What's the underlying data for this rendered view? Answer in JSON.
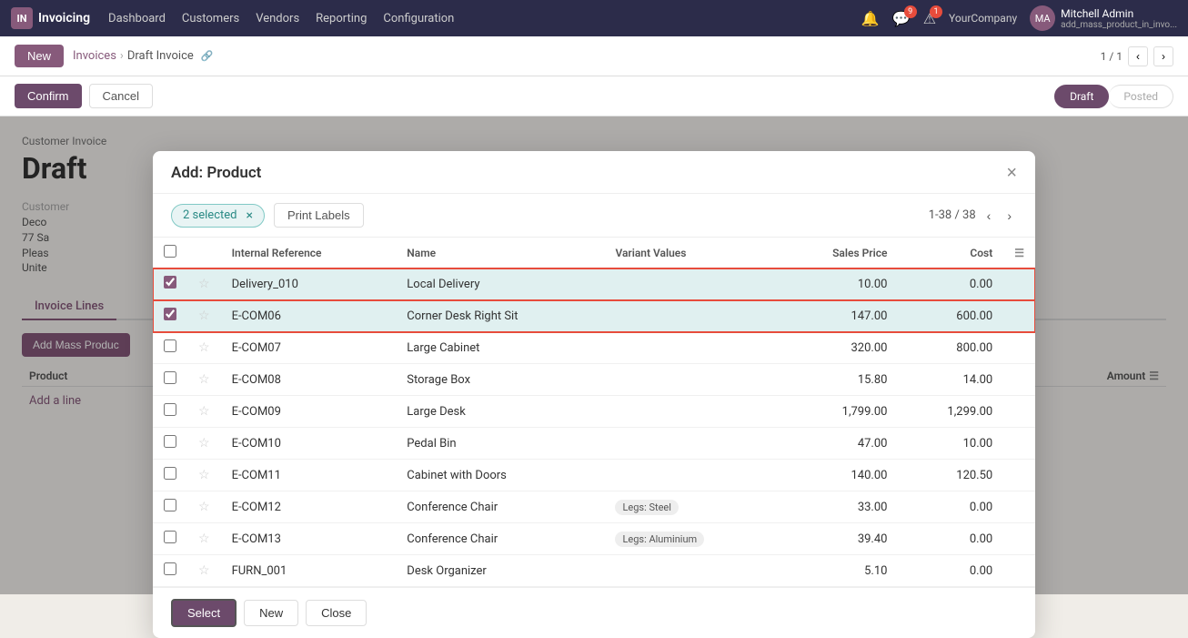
{
  "topnav": {
    "app_name": "Invoicing",
    "logo_text": "IN",
    "menu_items": [
      "Dashboard",
      "Customers",
      "Vendors",
      "Reporting",
      "Configuration"
    ],
    "company": "YourCompany",
    "user_name": "Mitchell Admin",
    "user_subtitle": "add_mass_product_in_invo...",
    "bell_badge": "",
    "msg_badge": "9",
    "alert_badge": "1"
  },
  "actionbar": {
    "new_label": "New",
    "breadcrumb_parent": "Invoices",
    "breadcrumb_child": "Draft Invoice",
    "page_info": "1 / 1"
  },
  "subactionbar": {
    "confirm_label": "Confirm",
    "cancel_label": "Cancel",
    "status_draft": "Draft",
    "status_posted": "Posted"
  },
  "invoice": {
    "type": "Customer Invoice",
    "status": "Draft",
    "customer_label": "Customer",
    "customer_info": "Deco\n77 Sa\nPleas\nUnite"
  },
  "tabs": [
    {
      "id": "invoice-lines",
      "label": "Invoice Lines",
      "active": true
    }
  ],
  "invoice_table": {
    "product_col": "Product",
    "amount_col": "Amount",
    "add_line": "Add a line",
    "add_mass_btn": "Add Mass Produc"
  },
  "dialog": {
    "title": "Add: Product",
    "close_label": "×",
    "selected_text": "2 selected",
    "print_labels": "Print Labels",
    "pagination": "1-38 / 38",
    "columns": {
      "internal_ref": "Internal Reference",
      "name": "Name",
      "variant_values": "Variant Values",
      "sales_price": "Sales Price",
      "cost": "Cost"
    },
    "rows": [
      {
        "id": "row-delivery010",
        "checked": true,
        "starred": false,
        "internal_ref": "Delivery_010",
        "name": "Local Delivery",
        "variant": "",
        "sales_price": "10.00",
        "cost": "0.00",
        "selected": true
      },
      {
        "id": "row-ecom06",
        "checked": true,
        "starred": false,
        "internal_ref": "E-COM06",
        "name": "Corner Desk Right Sit",
        "variant": "",
        "sales_price": "147.00",
        "cost": "600.00",
        "selected": true
      },
      {
        "id": "row-ecom07",
        "checked": false,
        "starred": false,
        "internal_ref": "E-COM07",
        "name": "Large Cabinet",
        "variant": "",
        "sales_price": "320.00",
        "cost": "800.00",
        "selected": false
      },
      {
        "id": "row-ecom08",
        "checked": false,
        "starred": false,
        "internal_ref": "E-COM08",
        "name": "Storage Box",
        "variant": "",
        "sales_price": "15.80",
        "cost": "14.00",
        "selected": false
      },
      {
        "id": "row-ecom09",
        "checked": false,
        "starred": false,
        "internal_ref": "E-COM09",
        "name": "Large Desk",
        "variant": "",
        "sales_price": "1,799.00",
        "cost": "1,299.00",
        "selected": false
      },
      {
        "id": "row-ecom10",
        "checked": false,
        "starred": false,
        "internal_ref": "E-COM10",
        "name": "Pedal Bin",
        "variant": "",
        "sales_price": "47.00",
        "cost": "10.00",
        "selected": false
      },
      {
        "id": "row-ecom11",
        "checked": false,
        "starred": false,
        "internal_ref": "E-COM11",
        "name": "Cabinet with Doors",
        "variant": "",
        "sales_price": "140.00",
        "cost": "120.50",
        "selected": false
      },
      {
        "id": "row-ecom12",
        "checked": false,
        "starred": false,
        "internal_ref": "E-COM12",
        "name": "Conference Chair",
        "variant": "Legs: Steel",
        "sales_price": "33.00",
        "cost": "0.00",
        "selected": false
      },
      {
        "id": "row-ecom13",
        "checked": false,
        "starred": false,
        "internal_ref": "E-COM13",
        "name": "Conference Chair",
        "variant": "Legs: Aluminium",
        "sales_price": "39.40",
        "cost": "0.00",
        "selected": false
      },
      {
        "id": "row-furn001",
        "checked": false,
        "starred": false,
        "internal_ref": "FURN_001",
        "name": "Desk Organizer",
        "variant": "",
        "sales_price": "5.10",
        "cost": "0.00",
        "selected": false
      }
    ],
    "footer": {
      "select_label": "Select",
      "new_label": "New",
      "close_label": "Close"
    }
  }
}
